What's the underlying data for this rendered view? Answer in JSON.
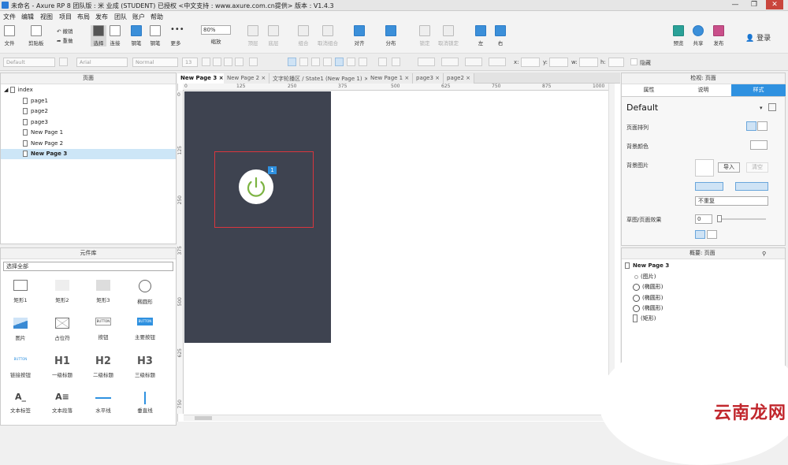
{
  "window": {
    "title": "未命名 - Axure RP 8 团队版 : 米 业成 (STUDENT) 已授权    <中文支持 : www.axure.com.cn提供> 版本 : V1.4.3",
    "controls": [
      "—",
      "❐",
      "✕"
    ]
  },
  "menu": [
    "文件",
    "编辑",
    "视图",
    "项目",
    "布局",
    "发布",
    "团队",
    "账户",
    "帮助"
  ],
  "toolbar": {
    "file": "文件",
    "clipboard": "剪贴板",
    "undo": "撤销",
    "redo": "重做",
    "select": "选择",
    "connect": "连接",
    "pen": "钢笔",
    "more": "更多",
    "zoom_value": "80%",
    "zoom_label": "缩放",
    "top": "顶层",
    "bottom": "底层",
    "group": "组合",
    "ungroup": "取消组合",
    "align": "对齐",
    "distribute": "分布",
    "lock": "锁定",
    "unlock": "取消锁定",
    "left": "左",
    "right": "右",
    "preview": "预览",
    "share": "共享",
    "publish": "发布",
    "login": "登录"
  },
  "format": {
    "style": "Default",
    "font": "Arial",
    "weight": "Normal",
    "size": "13",
    "x_label": "x:",
    "y_label": "y:",
    "w_label": "w:",
    "h_label": "h:",
    "hidden": "隐藏"
  },
  "pages_panel": {
    "title": "页面",
    "items": [
      {
        "label": "index"
      },
      {
        "label": "page1"
      },
      {
        "label": "page2"
      },
      {
        "label": "page3"
      },
      {
        "label": "New Page 1"
      },
      {
        "label": "New Page 2"
      },
      {
        "label": "New Page 3"
      }
    ]
  },
  "library_panel": {
    "title": "元件库",
    "select_all": "选择全部",
    "items": [
      {
        "label": "矩形1",
        "icon": "rect-1-icon"
      },
      {
        "label": "矩形2",
        "icon": "rect-2-icon"
      },
      {
        "label": "矩形3",
        "icon": "rect-3-icon"
      },
      {
        "label": "椭圆形",
        "icon": "ellipse-icon"
      },
      {
        "label": "图片",
        "icon": "image-icon"
      },
      {
        "label": "占位符",
        "icon": "placeholder-icon"
      },
      {
        "label": "按钮",
        "icon": "button-icon",
        "text": "BUTTON"
      },
      {
        "label": "主要按钮",
        "icon": "primary-button-icon",
        "text": "BUTTON"
      },
      {
        "label": "链接按钮",
        "icon": "link-button-icon",
        "text": "BUTTON"
      },
      {
        "label": "一级标题",
        "icon": "h1-icon",
        "text": "H1"
      },
      {
        "label": "二级标题",
        "icon": "h2-icon",
        "text": "H2"
      },
      {
        "label": "三级标题",
        "icon": "h3-icon",
        "text": "H3"
      },
      {
        "label": "文本标签",
        "icon": "text-label-icon",
        "text": "A_"
      },
      {
        "label": "文本段落",
        "icon": "text-paragraph-icon",
        "text": "A≡"
      },
      {
        "label": "水平线",
        "icon": "hline-icon"
      },
      {
        "label": "垂直线",
        "icon": "vline-icon"
      }
    ]
  },
  "tabs": [
    {
      "label": "New Page 3",
      "active": true
    },
    {
      "label": "New Page 2"
    },
    {
      "label": "文字轮播区 / State1 (New Page 1)"
    },
    {
      "label": "New Page 1"
    },
    {
      "label": "page3"
    },
    {
      "label": "page2"
    }
  ],
  "ruler": {
    "h": [
      "0",
      "125",
      "250",
      "375",
      "500",
      "625",
      "750",
      "875",
      "1000"
    ],
    "v": [
      "0",
      "125",
      "250",
      "375",
      "500",
      "625",
      "750"
    ]
  },
  "canvas": {
    "badge": "1",
    "bg_color": "#3e4350",
    "icon_color": "#7cb342"
  },
  "inspector": {
    "title": "检视: 页面",
    "tabs": [
      "属性",
      "说明",
      "样式"
    ],
    "style_name": "Default",
    "page_align": "页面排列",
    "bg_color": "背景颜色",
    "bg_image": "背景图片",
    "import": "导入",
    "clear": "清空",
    "repeat": "不重复",
    "sketch": "草图/页面效果",
    "sketch_value": "0"
  },
  "outline": {
    "title": "概要: 页面",
    "page": "New Page 3",
    "items": [
      "(图片)",
      "(椭圆形)",
      "(椭圆形)",
      "(椭圆形)",
      "(矩形)"
    ]
  },
  "watermark": "云南龙网"
}
